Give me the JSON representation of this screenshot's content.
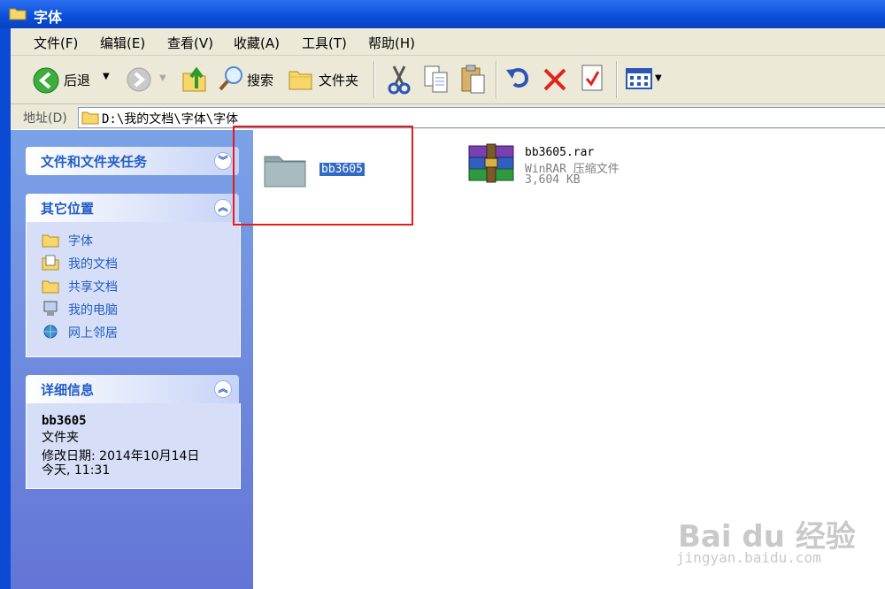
{
  "window": {
    "title": "字体"
  },
  "menu": [
    "文件(F)",
    "编辑(E)",
    "查看(V)",
    "收藏(A)",
    "工具(T)",
    "帮助(H)"
  ],
  "toolbar": {
    "back_label": "后退",
    "search_label": "搜索",
    "folders_label": "文件夹"
  },
  "address": {
    "label": "地址(D)",
    "path": "D:\\我的文档\\字体\\字体"
  },
  "tasks_panel": {
    "title": "文件和文件夹任务"
  },
  "other_places": {
    "title": "其它位置",
    "items": [
      "字体",
      "我的文档",
      "共享文档",
      "我的电脑",
      "网上邻居"
    ]
  },
  "details": {
    "title": "详细信息",
    "name": "bb3605",
    "type": "文件夹",
    "modified_line1": "修改日期: 2014年10月14日",
    "modified_line2": "今天, 11:31"
  },
  "files": [
    {
      "name": "bb3605",
      "kind": "folder",
      "selected": true
    },
    {
      "name": "bb3605.rar",
      "type": "WinRAR 压缩文件",
      "size": "3,604 KB"
    }
  ],
  "watermark": {
    "brand": "Bai du 经验",
    "url": "jingyan.baidu.com"
  },
  "colors": {
    "title_bar": "#0a4fd8",
    "task_pane": "#6b8ee0",
    "link": "#215dc6",
    "highlight": "#e21c1c"
  }
}
